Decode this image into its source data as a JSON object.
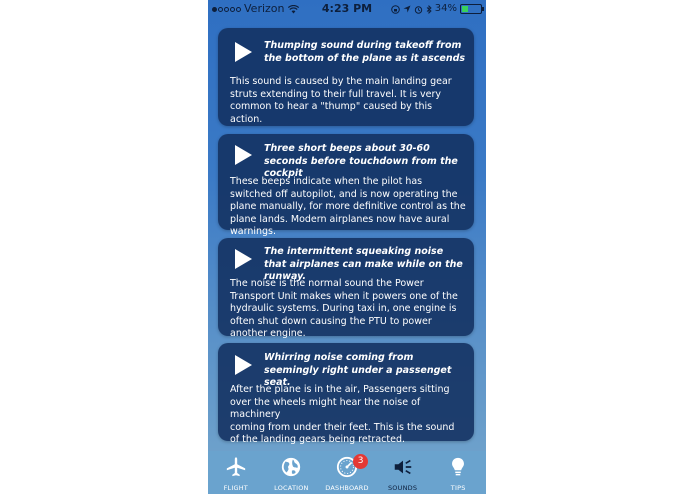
{
  "status_bar": {
    "carrier": "Verizon",
    "time": "4:23 PM",
    "battery_percent": "34%",
    "battery_level": 0.34,
    "signal_icons": [
      "wifi-icon",
      "location-icon",
      "alarm-icon",
      "bluetooth-icon"
    ]
  },
  "cards": [
    {
      "title": "Thumping sound during takeoff from the bottom of the plane as it ascends",
      "description": "This sound is caused by the main landing gear struts extending to their full travel. It is very common to hear a \"thump\" caused by this action."
    },
    {
      "title": "Three short beeps about 30-60 seconds before touchdown from the cockpit",
      "description": "These beeps indicate when the pilot has switched off autopilot, and is now operating the plane manually, for more definitive control as the plane lands. Modern airplanes now have aural warnings."
    },
    {
      "title": "The intermittent squeaking noise that airplanes can make while on the runway.",
      "description": "The noise is the normal sound the Power Transport Unit makes when it powers one of the hydraulic systems. During taxi in, one engine is often shut down causing the PTU to power another engine."
    },
    {
      "title": "Whirring noise coming from seemingly right under a passenget seat.",
      "description": "After the plane is in the air, Passengers sitting over the wheels might hear the noise of machinery\n coming from under their feet. This is the sound of the landing gears being retracted."
    }
  ],
  "tabs": [
    {
      "label": "FLIGHT",
      "icon": "airplane-icon"
    },
    {
      "label": "LOCATION",
      "icon": "globe-icon"
    },
    {
      "label": "DASHBOARD",
      "icon": "gauge-icon",
      "badge": "3"
    },
    {
      "label": "SOUNDS",
      "icon": "speaker-icon",
      "active": true
    },
    {
      "label": "TIPS",
      "icon": "lightbulb-icon"
    }
  ],
  "colors": {
    "card_bg": "#123060",
    "badge": "#e53935",
    "tabbar": "#6aa3ce",
    "active_tab": "#0d1f3c"
  }
}
